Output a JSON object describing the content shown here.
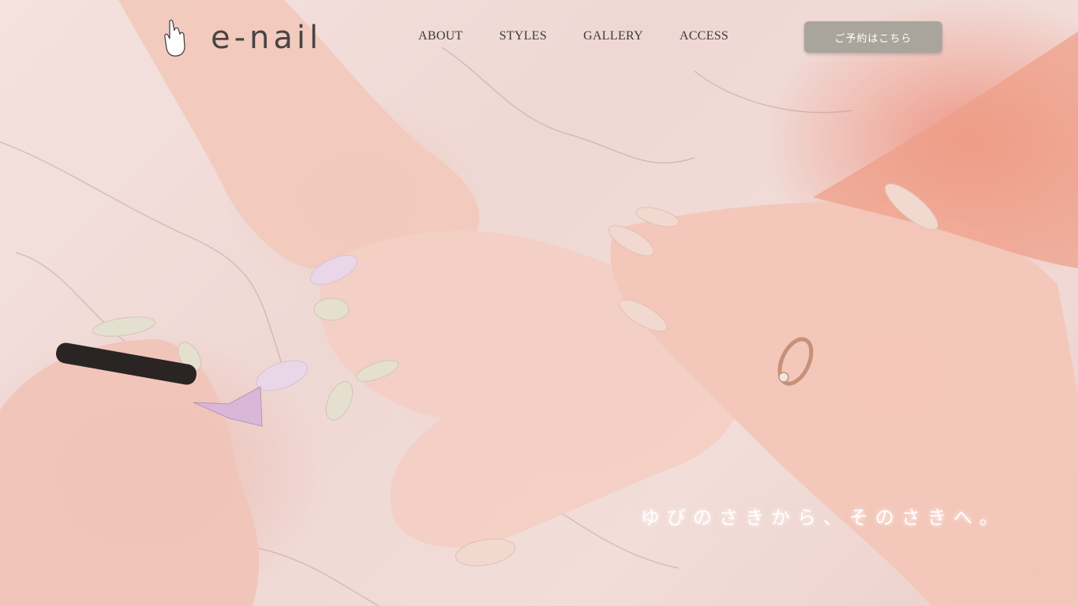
{
  "brand": {
    "name": "e-nail"
  },
  "nav": {
    "items": [
      "ABOUT",
      "STYLES",
      "GALLERY",
      "ACCESS"
    ]
  },
  "reserve_button": {
    "label": "ご予約はこちら"
  },
  "hero": {
    "tagline": "ゆびのさきから、そのさきへ。",
    "image_description": "hands receiving a nail manicure on a pink marble surface"
  },
  "colors": {
    "text": "#3c3838",
    "logo": "#4a4444",
    "button": "#a9a59c",
    "background": "#f4e2df"
  },
  "icons": {
    "logo": "hand-icon"
  }
}
